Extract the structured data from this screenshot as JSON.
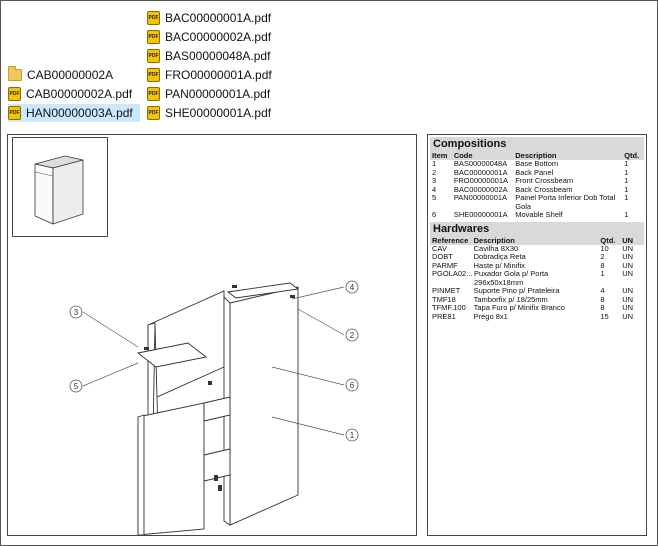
{
  "files": {
    "col1": [
      {
        "name": "CAB00000002A",
        "icon": "folder-icon",
        "selected": false
      },
      {
        "name": "CAB00000002A.pdf",
        "icon": "pdf-icon",
        "selected": false
      },
      {
        "name": "HAN00000003A.pdf",
        "icon": "pdf-icon",
        "selected": true
      }
    ],
    "col2": [
      {
        "name": "BAC00000001A.pdf",
        "icon": "pdf-icon"
      },
      {
        "name": "BAC00000002A.pdf",
        "icon": "pdf-icon"
      },
      {
        "name": "BAS00000048A.pdf",
        "icon": "pdf-icon"
      },
      {
        "name": "FRO00000001A.pdf",
        "icon": "pdf-icon"
      },
      {
        "name": "PAN00000001A.pdf",
        "icon": "pdf-icon"
      },
      {
        "name": "SHE00000001A.pdf",
        "icon": "pdf-icon"
      }
    ],
    "pdf_icon_text": "PDF"
  },
  "drawing": {
    "callouts": [
      "1",
      "2",
      "3",
      "4",
      "5",
      "6"
    ]
  },
  "compositions": {
    "title": "Compositions",
    "headers": {
      "item": "Item",
      "code": "Code",
      "description": "Description",
      "qty": "Qtd."
    },
    "rows": [
      {
        "item": "1",
        "code": "BAS00000048A",
        "description": "Base Bottom",
        "qty": "1"
      },
      {
        "item": "2",
        "code": "BAC00000001A",
        "description": "Back Panel",
        "qty": "1"
      },
      {
        "item": "3",
        "code": "FRO00000001A",
        "description": "Front Crossbeam",
        "qty": "1"
      },
      {
        "item": "4",
        "code": "BAC00000002A",
        "description": "Back Crossbeam",
        "qty": "1"
      },
      {
        "item": "5",
        "code": "PAN00000001A",
        "description": "Painel Porta Inferior Dob Total Gola",
        "qty": "1"
      },
      {
        "item": "6",
        "code": "SHE00000001A",
        "description": "Movable Shelf",
        "qty": "1"
      }
    ]
  },
  "hardwares": {
    "title": "Hardwares",
    "headers": {
      "reference": "Reference",
      "description": "Description",
      "qty": "Qtd.",
      "unit": "UN"
    },
    "rows": [
      {
        "reference": "CAV",
        "description": "Cavilha 8X30",
        "qty": "10",
        "unit": "UN"
      },
      {
        "reference": "DOBT",
        "description": "Dobradiça Reta",
        "qty": "2",
        "unit": "UN"
      },
      {
        "reference": "PARMF",
        "description": "Haste p/ Minifix",
        "qty": "8",
        "unit": "UN"
      },
      {
        "reference": "PGOLA02...",
        "description": "Puxador Gola p/ Porta 296x50x18mm",
        "qty": "1",
        "unit": "UN"
      },
      {
        "reference": "PINMET",
        "description": "Suporte Pino p/ Prateleira",
        "qty": "4",
        "unit": "UN"
      },
      {
        "reference": "TMF18",
        "description": "Tamborfix p/ 18/25mm",
        "qty": "8",
        "unit": "UN"
      },
      {
        "reference": "TFMF.100",
        "description": "Tapa Furo p/ Minifix Branco",
        "qty": "8",
        "unit": "UN"
      },
      {
        "reference": "PRE81",
        "description": "Prego 8x1",
        "qty": "15",
        "unit": "UN"
      }
    ]
  }
}
